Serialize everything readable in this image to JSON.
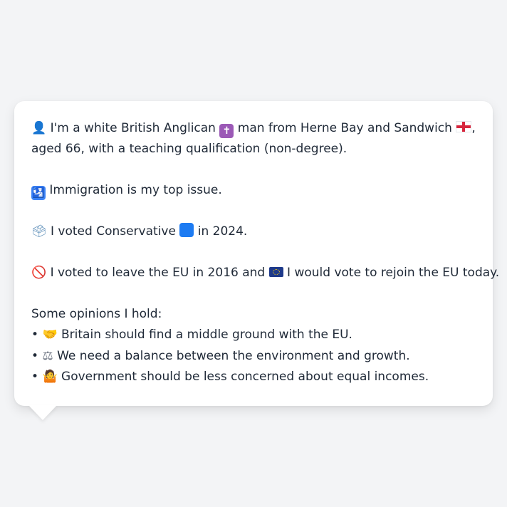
{
  "card": {
    "intro": {
      "icon_person": "👤",
      "text_a": "I'm a white British Anglican",
      "icon_cross": "✝",
      "text_b": "man from Herne Bay and Sandwich",
      "icon_flag": "🏴",
      "text_c": ",",
      "line2": "aged 66, with a teaching qualification (non-degree)."
    },
    "issue": {
      "icon": "🛂",
      "text": "Immigration is my top issue."
    },
    "vote2024": {
      "icon": "🗳",
      "text_a": "I voted Conservative",
      "icon_party": "🟦",
      "text_b": "in 2024."
    },
    "eu": {
      "icon_no": "🚫",
      "text_a": "I voted to leave the EU in 2016 and",
      "icon_eu": "🇪🇺",
      "text_b": "I would vote to rejoin the EU today."
    },
    "opinions": {
      "heading": "Some opinions I hold:",
      "items": [
        {
          "bullet": "•",
          "icon": "🤝",
          "text": "Britain should find a middle ground with the EU."
        },
        {
          "bullet": "•",
          "icon": "⚖",
          "text": "We need a balance between the environment and growth."
        },
        {
          "bullet": "•",
          "icon": "🤷",
          "text": "Government should be less concerned about equal incomes."
        }
      ]
    }
  },
  "colors": {
    "page_bg": "#f3f4f6",
    "card_bg": "#ffffff",
    "text": "#1f2937",
    "cross_box": "#9b59b6",
    "passport_box": "#3b82f6",
    "party_box": "#1d7bf2",
    "flag_red": "#d7263d"
  }
}
